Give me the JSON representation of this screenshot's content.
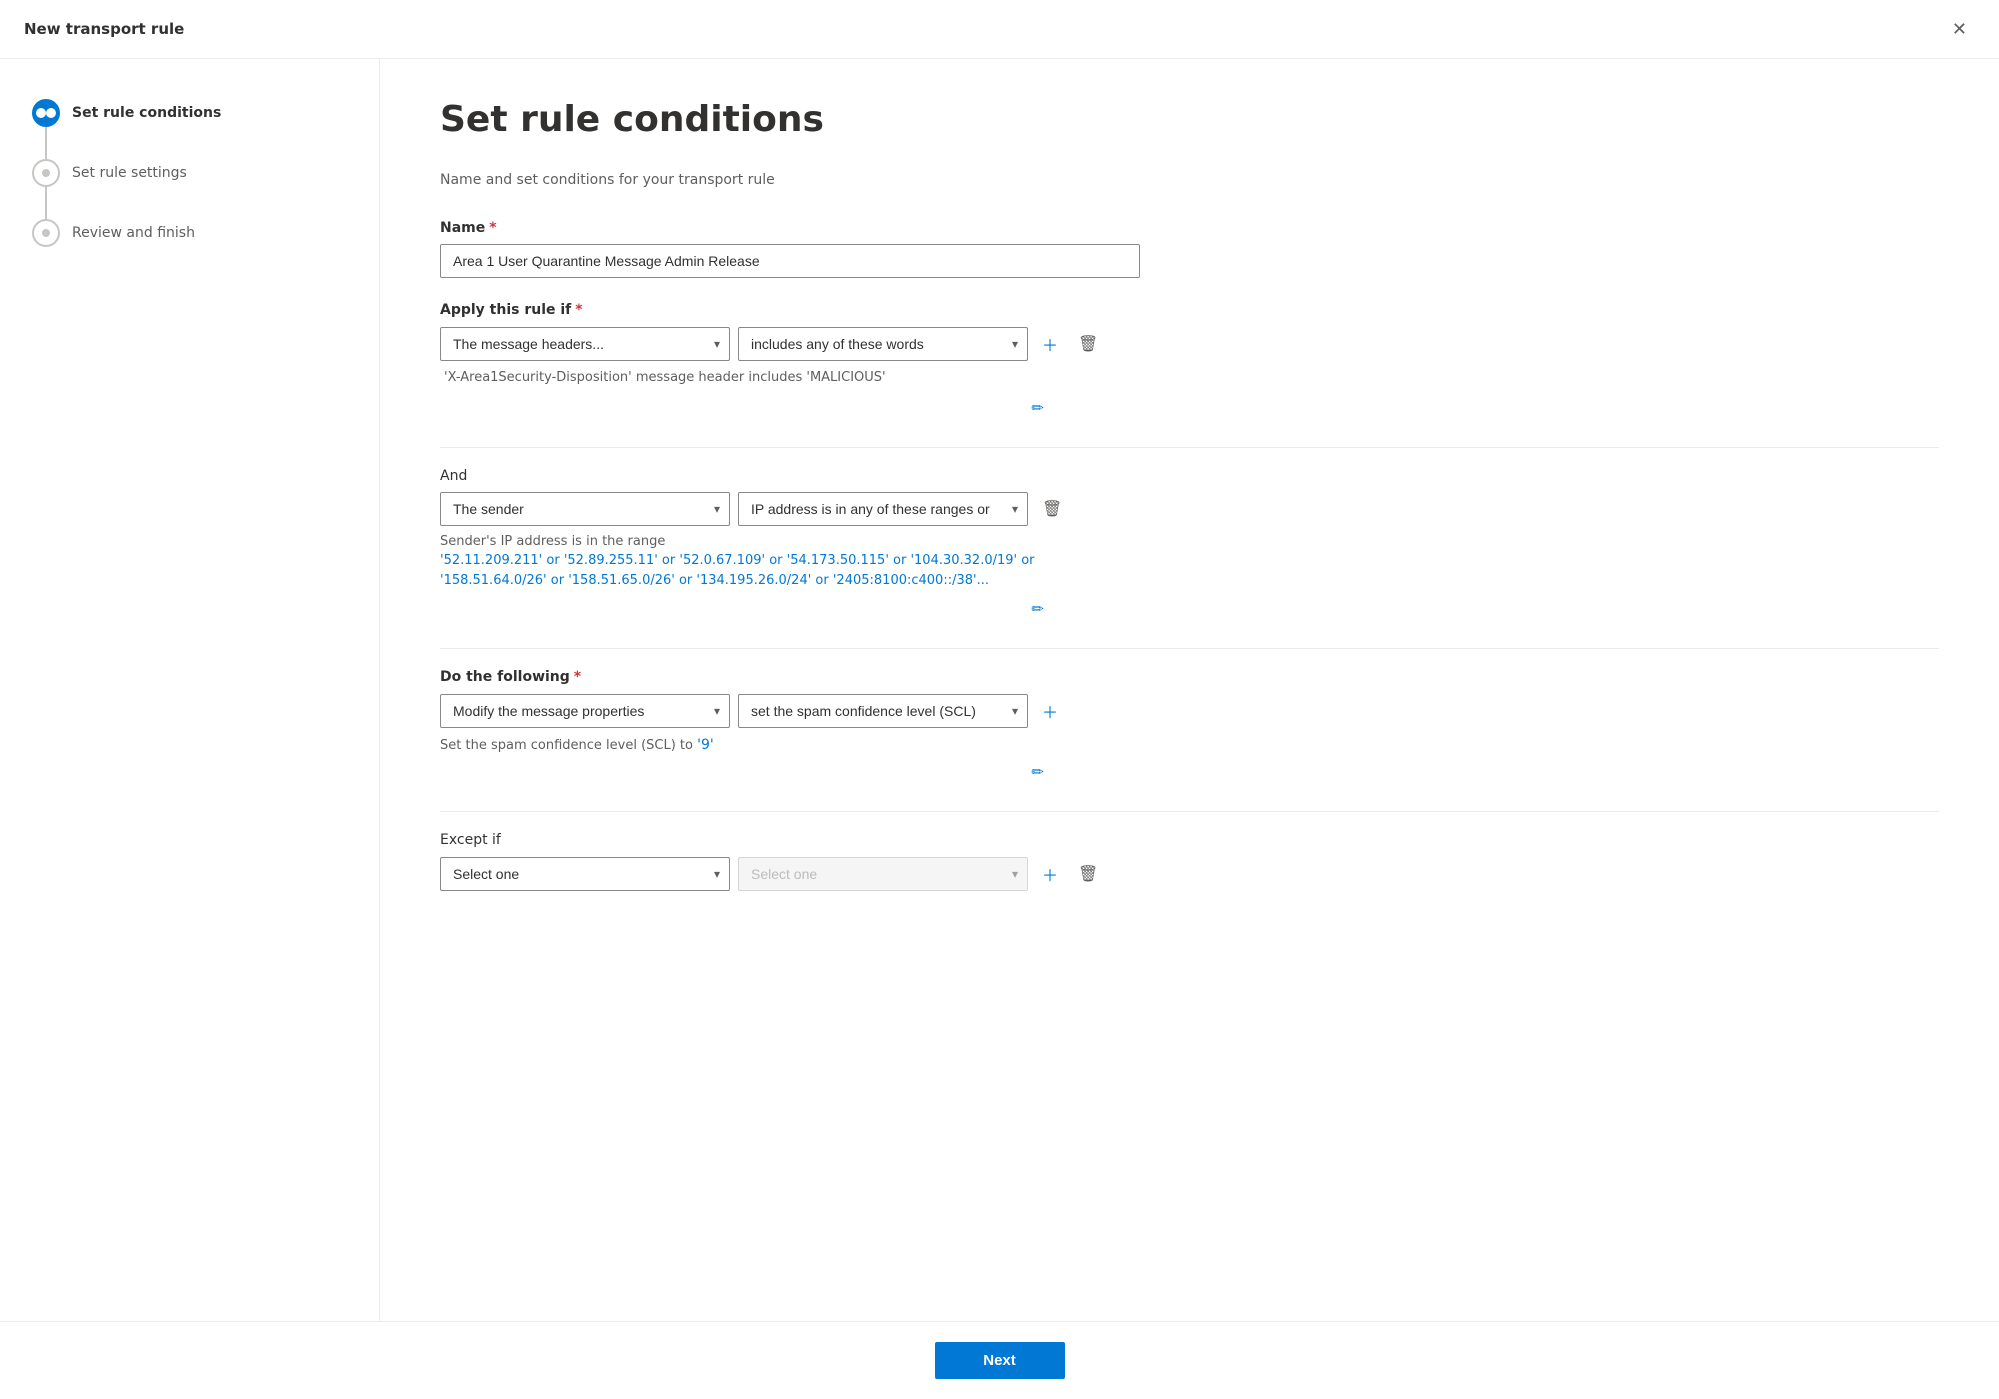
{
  "window": {
    "title": "New transport rule",
    "close_label": "✕"
  },
  "sidebar": {
    "steps": [
      {
        "id": "step-rule-conditions",
        "label": "Set rule conditions",
        "state": "active"
      },
      {
        "id": "step-rule-settings",
        "label": "Set rule settings",
        "state": "inactive"
      },
      {
        "id": "step-review-finish",
        "label": "Review and finish",
        "state": "inactive"
      }
    ]
  },
  "content": {
    "page_title": "Set rule conditions",
    "page_subtitle": "Name and set conditions for your transport rule",
    "name_label": "Name",
    "name_value": "Area 1 User Quarantine Message Admin Release",
    "apply_rule_label": "Apply this rule if",
    "apply_condition_1": {
      "dropdown1_value": "The message headers...",
      "dropdown2_value": "includes any of these words",
      "description_prefix": "'X-Area1Security-Disposition'",
      "description_middle": " message header includes ",
      "description_suffix": "'MALICIOUS'"
    },
    "and_label": "And",
    "apply_condition_2": {
      "dropdown1_value": "The sender",
      "dropdown2_value": "IP address is in any of these ranges or ...",
      "ip_prefix": "Sender's IP address is in the range",
      "ip_ranges": "'52.11.209.211' or '52.89.255.11' or '52.0.67.109' or '54.173.50.115' or '104.30.32.0/19' or '158.51.64.0/26' or '158.51.65.0/26' or '134.195.26.0/24' or '2405:8100:c400::/38'..."
    },
    "do_following_label": "Do the following",
    "do_condition_1": {
      "dropdown1_value": "Modify the message properties",
      "dropdown2_value": "set the spam confidence level (SCL)",
      "description": "Set the spam confidence level (SCL) to ",
      "scl_value": "'9'"
    },
    "except_if_label": "Except if",
    "except_condition_1": {
      "dropdown1_value": "Select one",
      "dropdown2_value": "Select one"
    },
    "footer": {
      "next_label": "Next"
    }
  }
}
